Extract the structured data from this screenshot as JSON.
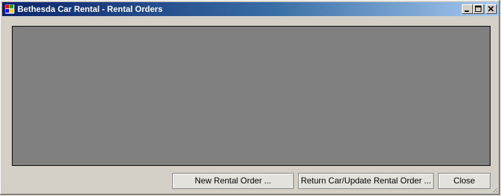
{
  "window": {
    "title": "Bethesda Car Rental - Rental Orders",
    "icon": "app-window-icon",
    "caption_buttons": [
      "minimize-icon",
      "maximize-icon",
      "close-icon"
    ]
  },
  "buttons": {
    "new_rental_order": "New Rental Order ...",
    "return_car": "Return Car/Update Rental Order ...",
    "close": "Close"
  },
  "colors": {
    "panel_background": "#808080",
    "window_background": "#d4d0c8",
    "titlebar_start": "#0a246a",
    "titlebar_end": "#a6caf0"
  }
}
